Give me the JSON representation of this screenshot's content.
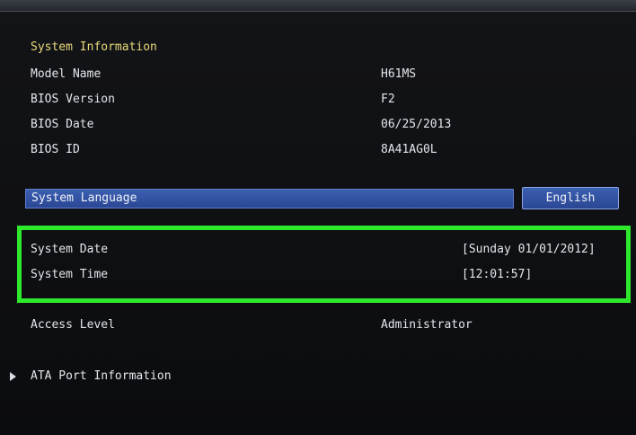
{
  "system_information": {
    "heading": "System Information",
    "items": [
      {
        "label": "Model Name",
        "value": "H61MS"
      },
      {
        "label": "BIOS Version",
        "value": "F2"
      },
      {
        "label": "BIOS Date",
        "value": "06/25/2013"
      },
      {
        "label": "BIOS ID",
        "value": "8A41AG0L"
      }
    ]
  },
  "language": {
    "label": "System Language",
    "value": "English"
  },
  "datetime": {
    "date_label": "System Date",
    "date_value": "[Sunday 01/01/2012]",
    "time_label": "System Time",
    "time_value": "[12:01:57]"
  },
  "access": {
    "label": "Access Level",
    "value": "Administrator"
  },
  "ata": {
    "label": "ATA Port Information",
    "arrow_icon": "triangle-right-icon"
  },
  "colors": {
    "heading": "#e8d87a",
    "selection": "#3c5fb0",
    "highlight": "#2ee82b",
    "background": "#0e0f12"
  }
}
